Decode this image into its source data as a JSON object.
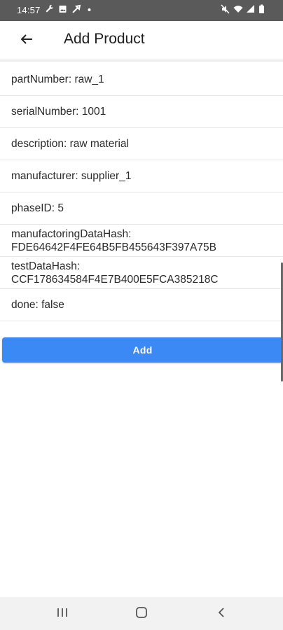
{
  "status_bar": {
    "time": "14:57",
    "left_icons": [
      "wrench-icon",
      "image-icon",
      "wrench-icon",
      "dot-icon"
    ],
    "right_icons": [
      "mute-icon",
      "wifi-icon",
      "signal-icon",
      "battery-icon"
    ]
  },
  "header": {
    "title": "Add Product",
    "back_icon": "arrow-left-icon"
  },
  "fields": [
    {
      "lines": [
        "partNumber: raw_1"
      ]
    },
    {
      "lines": [
        "serialNumber: 1001"
      ]
    },
    {
      "lines": [
        "description: raw material"
      ]
    },
    {
      "lines": [
        "manufacturer: supplier_1"
      ]
    },
    {
      "lines": [
        "phaseID: 5"
      ]
    },
    {
      "lines": [
        "manufactoringDataHash:",
        "FDE64642F4FE64B5FB455643F397A75B"
      ]
    },
    {
      "lines": [
        "testDataHash:",
        "CCF178634584F4E7B400E5FCA385218C"
      ]
    },
    {
      "lines": [
        "done: false"
      ]
    }
  ],
  "add_button": {
    "label": "Add",
    "color": "#3a89f5"
  },
  "nav_bar": {
    "recents_icon": "recents-icon",
    "home_icon": "home-icon",
    "back_icon": "back-chevron-icon"
  }
}
